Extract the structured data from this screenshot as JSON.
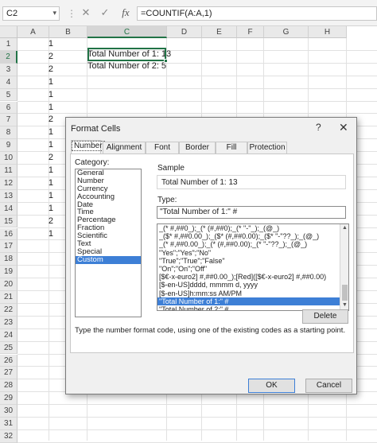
{
  "formula_bar": {
    "name_box": "C2",
    "name_box_dropdown": "▾",
    "dots": "⋮",
    "cancel": "✕",
    "enter": "✓",
    "fx": "fx",
    "formula": "=COUNTIF(A:A,1)"
  },
  "grid": {
    "columns": [
      "A",
      "B",
      "C",
      "D",
      "E",
      "F",
      "G",
      "H"
    ],
    "rows": [
      "1",
      "2",
      "3",
      "4",
      "5",
      "6",
      "7",
      "8",
      "9",
      "10",
      "11",
      "12",
      "13",
      "14",
      "15",
      "16",
      "17",
      "18",
      "19",
      "20",
      "21",
      "22",
      "23",
      "24",
      "25",
      "26",
      "27",
      "28",
      "29",
      "30",
      "31",
      "32"
    ],
    "column_a_values": [
      "1",
      "2",
      "2",
      "1",
      "1",
      "1",
      "2",
      "1",
      "1",
      "2",
      "1",
      "1",
      "1",
      "1",
      "2",
      "1"
    ],
    "c2": "Total Number of 1: 13",
    "c3": "Total Number of 2: 5"
  },
  "dialog": {
    "title": "Format Cells",
    "help": "?",
    "close": "✕",
    "tabs": [
      "Number",
      "Alignment",
      "Font",
      "Border",
      "Fill",
      "Protection"
    ],
    "active_tab": "Number",
    "category_label": "Category:",
    "categories": [
      "General",
      "Number",
      "Currency",
      "Accounting",
      "Date",
      "Time",
      "Percentage",
      "Fraction",
      "Scientific",
      "Text",
      "Special",
      "Custom"
    ],
    "selected_category": "Custom",
    "sample_label": "Sample",
    "sample_value": "Total Number of 1: 13",
    "type_label": "Type:",
    "type_value": "\"Total Number of 1:\" #",
    "type_list": [
      "_(* #,##0_);_(* (#,##0);_(* \"-\"_);_(@_)",
      "_($* #,##0.00_);_($* (#,##0.00);_($* \"-\"??_);_(@_)",
      "_(* #,##0.00_);_(* (#,##0.00);_(* \"-\"??_);_(@_)",
      "\"Yes\";\"Yes\";\"No\"",
      "\"True\";\"True\";\"False\"",
      "\"On\";\"On\";\"Off\"",
      "[$€-x-euro2] #,##0.00_);[Red]([$€-x-euro2] #,##0.00)",
      "[$-en-US]dddd, mmmm d, yyyy",
      "[$-en-US]h:mm:ss AM/PM",
      "\"Total Number of 1:\" #",
      "\"Total Number of 2:\" #"
    ],
    "selected_type": "\"Total Number of 1:\" #",
    "scroll_up": "▲",
    "scroll_down": "▼",
    "delete_button": "Delete",
    "description": "Type the number format code, using one of the existing codes as a starting point.",
    "ok_button": "OK",
    "cancel_button": "Cancel"
  }
}
